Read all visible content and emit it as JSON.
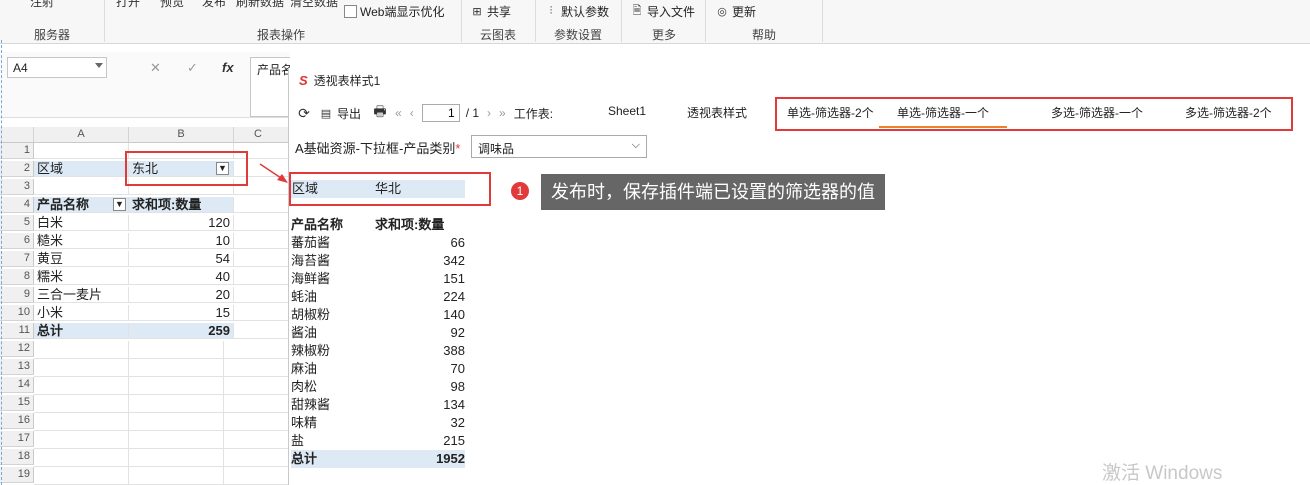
{
  "ribbon": {
    "cut_labels": [
      "注射",
      "打开",
      "预览",
      "发布",
      "刷新数据",
      "清空数据"
    ],
    "web_opt_label": "Web端显示优化",
    "share_label": "共享",
    "default_params_label": "默认参数",
    "import_file_label": "导入文件",
    "update_label": "更新",
    "groups": [
      "服务器",
      "报表操作",
      "云图表",
      "参数设置",
      "更多",
      "帮助"
    ]
  },
  "formula_bar": {
    "name_box": "A4",
    "cancel_icon": "✕",
    "confirm_icon": "✓",
    "fx_label": "fx",
    "content": "产品名称"
  },
  "spreadsheet": {
    "columns": [
      "A",
      "B",
      "C"
    ],
    "rows": [
      "1",
      "2",
      "3",
      "4",
      "5",
      "6",
      "7",
      "8",
      "9",
      "10",
      "11",
      "12",
      "13",
      "14",
      "15",
      "16",
      "17",
      "18",
      "19"
    ],
    "region_label": "区域",
    "region_value": "东北",
    "header_name": "产品名称",
    "header_sum": "求和项:数量",
    "items": [
      {
        "name": "白米",
        "qty": "120"
      },
      {
        "name": "糙米",
        "qty": "10"
      },
      {
        "name": "黄豆",
        "qty": "54"
      },
      {
        "name": "糯米",
        "qty": "40"
      },
      {
        "name": "三合一麦片",
        "qty": "20"
      },
      {
        "name": "小米",
        "qty": "15"
      }
    ],
    "total_label": "总计",
    "total_value": "259"
  },
  "viewer": {
    "title": "透视表样式1",
    "logo": "S",
    "export_label": "导出",
    "page_current": "1",
    "page_total": "/ 1",
    "worksheet_label": "工作表:",
    "tabs": [
      "Sheet1",
      "透视表样式",
      "单选-筛选器-2个",
      "单选-筛选器-一个",
      "多选-筛选器-一个",
      "多选-筛选器-2个"
    ],
    "filter_label": "A基础资源-下拉框-产品类别",
    "required_mark": "*",
    "filter_value": "调味品",
    "region_label": "区域",
    "region_value": "华北",
    "header_name": "产品名称",
    "header_sum": "求和项:数量",
    "items": [
      {
        "name": "蕃茄酱",
        "qty": "66"
      },
      {
        "name": "海苔酱",
        "qty": "342"
      },
      {
        "name": "海鲜酱",
        "qty": "151"
      },
      {
        "name": "蚝油",
        "qty": "224"
      },
      {
        "name": "胡椒粉",
        "qty": "140"
      },
      {
        "name": "酱油",
        "qty": "92"
      },
      {
        "name": "辣椒粉",
        "qty": "388"
      },
      {
        "name": "麻油",
        "qty": "70"
      },
      {
        "name": "肉松",
        "qty": "98"
      },
      {
        "name": "甜辣酱",
        "qty": "134"
      },
      {
        "name": "味精",
        "qty": "32"
      },
      {
        "name": "盐",
        "qty": "215"
      }
    ],
    "total_label": "总计",
    "total_value": "1952"
  },
  "annotation": {
    "badge": "1",
    "text": "发布时，保存插件端已设置的筛选器的值"
  },
  "watermark": "激活 Windows",
  "colors": {
    "accent_red": "#e03a3a",
    "active_tab": "#e8832a",
    "highlight": "#dde9f5"
  }
}
